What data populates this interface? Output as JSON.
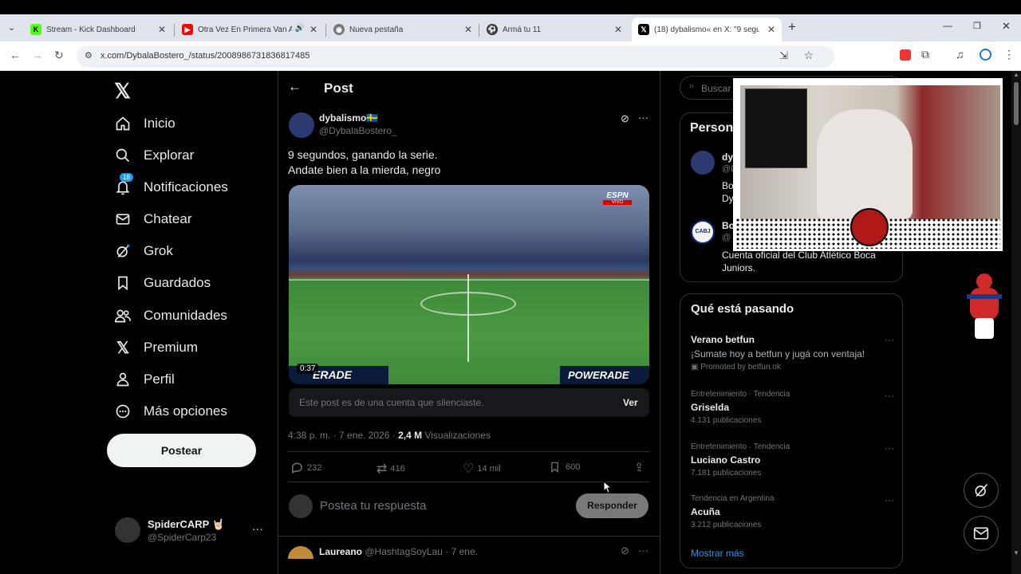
{
  "browser": {
    "tabs": [
      {
        "title": "Stream - Kick Dashboard",
        "icon": "kick-icon"
      },
      {
        "title": "Otra Vez En Primera Van A",
        "icon": "youtube-icon"
      },
      {
        "title": "Nueva pestaña",
        "icon": "chrome-icon"
      },
      {
        "title": "Armá tu 11",
        "icon": "soccer-ball-icon"
      },
      {
        "title": "(18) dybalismo« en X: \"9 segun",
        "icon": "x-logo-icon"
      }
    ],
    "url": "x.com/DybalaBostero_/status/2008986731836817485"
  },
  "sidebar": {
    "items": [
      {
        "label": "Inicio",
        "icon": "home-icon"
      },
      {
        "label": "Explorar",
        "icon": "search-icon"
      },
      {
        "label": "Notificaciones",
        "icon": "bell-icon",
        "badge": "18"
      },
      {
        "label": "Chatear",
        "icon": "mail-icon"
      },
      {
        "label": "Grok",
        "icon": "grok-icon"
      },
      {
        "label": "Guardados",
        "icon": "bookmark-icon"
      },
      {
        "label": "Comunidades",
        "icon": "people-icon"
      },
      {
        "label": "Premium",
        "icon": "x-logo-icon"
      },
      {
        "label": "Perfil",
        "icon": "person-icon"
      },
      {
        "label": "Más opciones",
        "icon": "more-circle-icon"
      }
    ],
    "post_button": "Postear",
    "account": {
      "name": "SpiderCARP 🤘🏻",
      "handle": "@SpiderCarp23"
    }
  },
  "main": {
    "header": "Post",
    "author": {
      "name": "dybalismo🇸🇪",
      "handle": "@DybalaBostero_"
    },
    "text_line1": "9 segundos, ganando la serie.",
    "text_line2": "Andate bien a la mierda, negro",
    "video": {
      "duration": "0:37",
      "channel": "ESPN",
      "channel_sub": "VIVO",
      "ad_left": "ERADE",
      "ad_right": "POWERADE"
    },
    "muted_notice": "Este post es de una cuenta que silenciaste.",
    "muted_action": "Ver",
    "timestamp": "4:38 p. m. · 7 ene. 2026 ·",
    "views_count": "2,4 M",
    "views_label": "Visualizaciones",
    "actions": {
      "replies": "232",
      "reposts": "416",
      "likes": "14 mil",
      "bookmarks": "600"
    },
    "reply_placeholder": "Postea tu respuesta",
    "reply_button": "Responder",
    "next_reply": {
      "name": "Laureano",
      "handle": "@HashtagSoyLau · 7 ene."
    }
  },
  "right": {
    "search_placeholder": "Buscar",
    "people_title": "Person",
    "people": [
      {
        "name": "dy",
        "handle": "@D",
        "bio1": "Bo",
        "bio2": "Dy"
      },
      {
        "name": "Bo",
        "handle": "@",
        "bio1": "Cuenta oficial del Club Atlético Boca",
        "bio2": "Juniors."
      }
    ],
    "trends_title": "Qué está pasando",
    "promo": {
      "name": "Verano betfun",
      "text": "¡Sumate hoy a betfun y jugá con ventaja!",
      "promoted": "Promoted by betfun.ok"
    },
    "trends": [
      {
        "category": "Entretenimiento · Tendencia",
        "name": "Griselda",
        "count": "4.131 publicaciones"
      },
      {
        "category": "Entretenimiento · Tendencia",
        "name": "Luciano Castro",
        "count": "7.181 publicaciones"
      },
      {
        "category": "Tendencia en Argentina",
        "name": "Acuña",
        "count": "3.212 publicaciones"
      }
    ],
    "show_more": "Mostrar más"
  }
}
